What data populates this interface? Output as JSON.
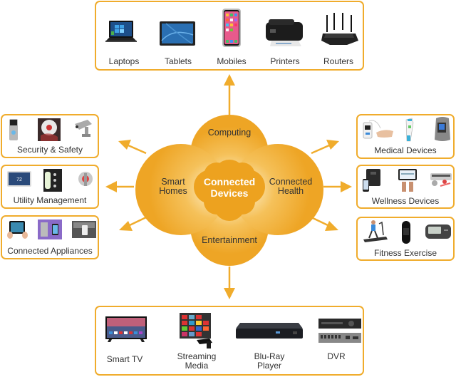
{
  "center": {
    "title_line1": "Connected",
    "title_line2": "Devices",
    "petals": {
      "top": "Computing",
      "left_line1": "Smart",
      "left_line2": "Homes",
      "right_line1": "Connected",
      "right_line2": "Health",
      "bottom": "Entertainment"
    }
  },
  "colors": {
    "accent": "#f0ac2c",
    "petal": "#f2b23c",
    "petal_highlight": "#fde8b8",
    "core": "#eda21f",
    "text": "#333333"
  },
  "computing": {
    "items": [
      {
        "label": "Laptops",
        "icon": "laptop-icon"
      },
      {
        "label": "Tablets",
        "icon": "tablet-icon"
      },
      {
        "label": "Mobiles",
        "icon": "mobile-phone-icon"
      },
      {
        "label": "Printers",
        "icon": "printer-icon"
      },
      {
        "label": "Routers",
        "icon": "router-icon"
      }
    ]
  },
  "entertainment": {
    "items": [
      {
        "label": "Smart TV",
        "icon": "smart-tv-icon"
      },
      {
        "label_line1": "Streaming",
        "label_line2": "Media",
        "icon": "streaming-media-icon"
      },
      {
        "label_line1": "Blu-Ray",
        "label_line2": "Player",
        "icon": "blu-ray-player-icon"
      },
      {
        "label": "DVR",
        "icon": "dvr-icon"
      }
    ]
  },
  "smart_homes": {
    "groups": [
      {
        "label": "Security & Safety",
        "icons": [
          "video-doorbell-icon",
          "smoke-detector-icon",
          "security-camera-icon"
        ]
      },
      {
        "label": "Utility Management",
        "icons": [
          "thermostat-icon",
          "smart-meter-icon",
          "sprinkler-icon"
        ]
      },
      {
        "label": "Connected Appliances",
        "icons": [
          "tablet-control-icon",
          "fridge-phone-icon",
          "kitchen-phone-icon"
        ]
      }
    ]
  },
  "connected_health": {
    "groups": [
      {
        "label": "Medical Devices",
        "icons": [
          "pulse-oximeter-icon",
          "thermometer-icon",
          "bp-cuff-icon"
        ]
      },
      {
        "label": "Wellness Devices",
        "icons": [
          "smart-scale-icon",
          "phone-app-icon",
          "sleep-monitor-icon"
        ]
      },
      {
        "label": "Fitness Exercise",
        "icons": [
          "treadmill-icon",
          "fitness-band-icon",
          "pedometer-icon"
        ]
      }
    ]
  }
}
